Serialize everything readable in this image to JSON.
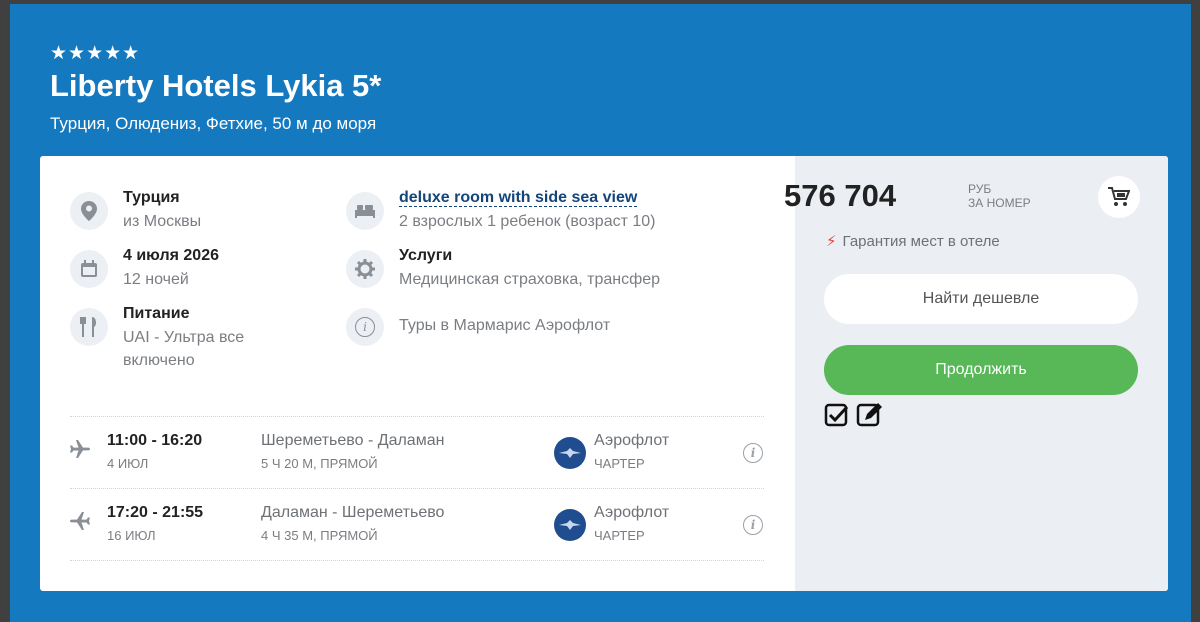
{
  "hotel": {
    "stars": "★★★★★",
    "name": "Liberty Hotels Lykia 5*",
    "location": "Турция, Олюдениз, Фетхие, 50 м до моря"
  },
  "details": {
    "country": {
      "icon": "location-pin-icon",
      "label": "Турция",
      "value": "из Москвы"
    },
    "date": {
      "icon": "calendar-icon",
      "label": "4 июля 2026",
      "value": "12 ночей"
    },
    "meal": {
      "icon": "cutlery-icon",
      "label": "Питание",
      "value1": "UAI - Ультра все",
      "value2": "включено"
    },
    "room": {
      "icon": "bed-icon",
      "label": "deluxe room with side sea view",
      "value": "2 взрослых 1 ребенок (возраст 10)"
    },
    "services": {
      "icon": "gear-icon",
      "label": "Услуги",
      "value": "Медицинская страховка, трансфер"
    },
    "tours": {
      "icon": "info-icon",
      "value": "Туры в Мармарис Аэрофлот"
    }
  },
  "flights": [
    {
      "time": "11:00 - 16:20",
      "date": "4 июл",
      "route": "Шереметьево - Даламан",
      "duration": "5 ч 20 м, прямой",
      "airline": "Аэрофлот",
      "type": "чартер"
    },
    {
      "time": "17:20 - 21:55",
      "date": "16 июл",
      "route": "Даламан - Шереметьево",
      "duration": "4 ч 35 м, прямой",
      "airline": "Аэрофлот",
      "type": "чартер"
    }
  ],
  "pricing": {
    "price": "576 704",
    "currency": "РУБ",
    "per": "ЗА НОМЕР",
    "guarantee": "Гарантия мест в отеле",
    "find_cheaper": "Найти дешевле",
    "continue": "Продолжить"
  },
  "colors": {
    "brand_blue": "#1479bf",
    "continue_green": "#58b858",
    "bolt_red": "#e8453c"
  }
}
